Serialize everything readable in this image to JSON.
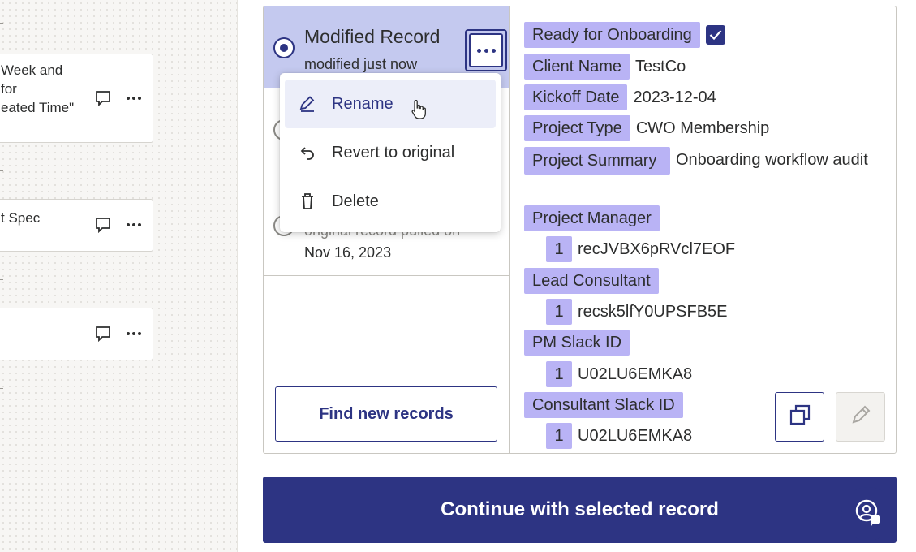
{
  "canvas": {
    "cards": [
      {
        "text": "Week and\nfor\neated Time\""
      },
      {
        "text": "t Spec"
      },
      {
        "text": ""
      }
    ]
  },
  "records": {
    "selected": {
      "title": "Modified Record",
      "subtitle": "modified just now"
    },
    "original": {
      "subtitle_partial": "original record pulled on",
      "date": "Nov 16, 2023"
    },
    "find_button": "Find new records"
  },
  "menu": {
    "items": [
      {
        "label": "Rename",
        "icon": "pencil-icon"
      },
      {
        "label": "Revert to original",
        "icon": "undo-icon"
      },
      {
        "label": "Delete",
        "icon": "trash-icon"
      }
    ]
  },
  "fields": {
    "ready_label": "Ready for Onboarding",
    "ready_checked": true,
    "client_label": "Client Name",
    "client_value": "TestCo",
    "kickoff_label": "Kickoff Date",
    "kickoff_value": "2023-12-04",
    "project_type_label": "Project Type",
    "project_type_value": "CWO Membership",
    "project_summary_label": "Project Summary",
    "project_summary_value": "Onboarding workflow audit",
    "pm_label": "Project Manager",
    "pm_index": "1",
    "pm_value": "recJVBX6pRVcl7EOF",
    "lead_label": "Lead Consultant",
    "lead_index": "1",
    "lead_value": "recsk5lfY0UPSFB5E",
    "pm_slack_label": "PM Slack ID",
    "pm_slack_index": "1",
    "pm_slack_value": "U02LU6EMKA8",
    "consultant_slack_label": "Consultant Slack ID",
    "consultant_slack_index": "1",
    "consultant_slack_value": "U02LU6EMKA8"
  },
  "continue_button": "Continue with selected record",
  "colors": {
    "primary": "#2d3483",
    "selected_bg": "#c4c9ef",
    "tag_bg": "#b9b3f5"
  }
}
